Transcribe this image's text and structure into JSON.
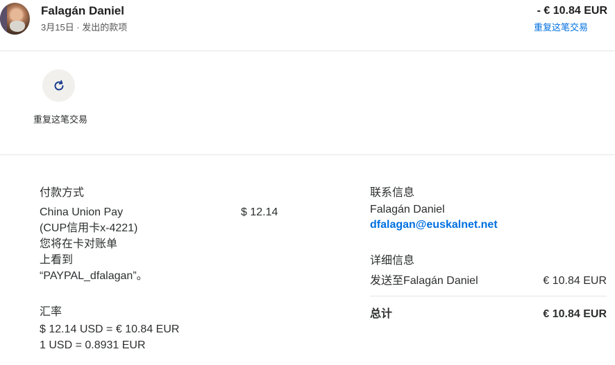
{
  "header": {
    "name": "Falagán Daniel",
    "subline": "3月15日 · 发出的款项",
    "amount": "- € 10.84 EUR",
    "repeat_link": "重复这笔交易"
  },
  "action": {
    "label": "重复这笔交易",
    "icon": "refresh-icon"
  },
  "payment": {
    "title": "付款方式",
    "method_lines": [
      "China Union Pay",
      "(CUP信用卡x-4221)",
      "您将在卡对账单",
      "上看到",
      "“PAYPAL_dfalagan”。"
    ],
    "amount": "$ 12.14"
  },
  "exchange": {
    "title": "汇率",
    "line1": "$ 12.14 USD = € 10.84 EUR",
    "line2": "1 USD = 0.8931 EUR"
  },
  "contact": {
    "title": "联系信息",
    "name": "Falagán Daniel",
    "email": "dfalagan@euskalnet.net"
  },
  "details": {
    "title": "详细信息",
    "sent_to_label": "发送至Falagán Daniel",
    "sent_to_amount": "€ 10.84 EUR",
    "total_label": "总计",
    "total_amount": "€ 10.84 EUR"
  },
  "colors": {
    "link": "#0070e0",
    "text": "#2c2e2f",
    "button_bg": "#f2f0ec"
  }
}
